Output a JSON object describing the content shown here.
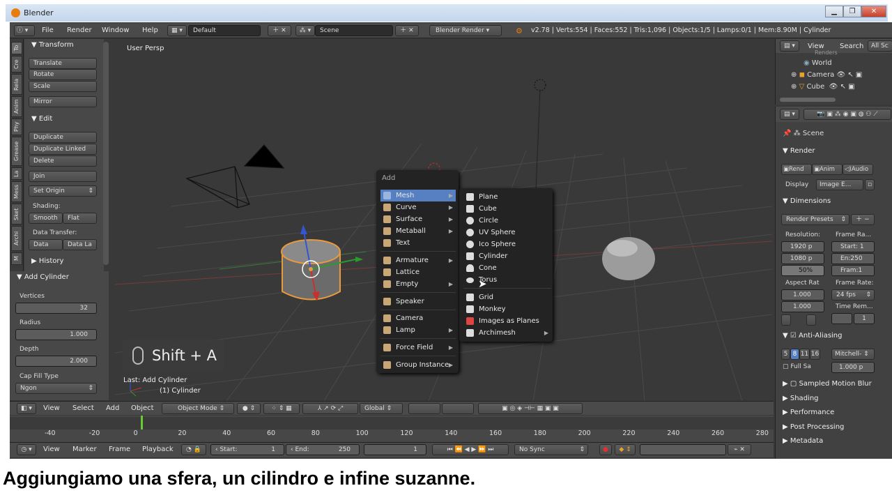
{
  "window": {
    "title": "Blender",
    "min": "▁",
    "max": "❐",
    "close": "✕"
  },
  "menubar": {
    "items": [
      "File",
      "Render",
      "Window",
      "Help"
    ],
    "layout": "Default",
    "scene": "Scene",
    "engine": "Blender Render",
    "stats": "v2.78 | Verts:554 | Faces:552 | Tris:1,096 | Objects:1/5 | Lamps:0/1 | Mem:8.90M | Cylinder"
  },
  "tabs": [
    "To",
    "Cre",
    "Rela",
    "Anim",
    "Phy",
    "Grease",
    "La",
    "Mess",
    "Sket",
    "Archi",
    "M"
  ],
  "tools": {
    "transform": {
      "title": "Transform",
      "buttons": [
        "Translate",
        "Rotate",
        "Scale",
        "Mirror"
      ]
    },
    "edit": {
      "title": "Edit",
      "buttons": [
        "Duplicate",
        "Duplicate Linked",
        "Delete",
        "Join"
      ],
      "set_origin": "Set Origin",
      "shading_label": "Shading:",
      "smooth": "Smooth",
      "flat": "Flat",
      "transfer_label": "Data Transfer:",
      "data": "Data",
      "data_la": "Data La"
    },
    "history": "History"
  },
  "operator": {
    "title": "Add Cylinder",
    "vertices_label": "Vertices",
    "vertices": "32",
    "radius_label": "Radius",
    "radius": "1.000",
    "depth_label": "Depth",
    "depth": "2.000",
    "cap_label": "Cap Fill Type",
    "cap": "Ngon"
  },
  "viewport": {
    "persp": "User Persp",
    "last_op": "Last: Add Cylinder",
    "object": "(1) Cylinder",
    "shortcut": "Shift + A"
  },
  "add_menu": {
    "title": "Add",
    "items": [
      {
        "label": "Mesh",
        "icon": "mesh-icon"
      },
      {
        "label": "Curve",
        "icon": "curve-icon"
      },
      {
        "label": "Surface",
        "icon": "surface-icon"
      },
      {
        "label": "Metaball",
        "icon": "metaball-icon"
      },
      {
        "label": "Text",
        "icon": "text-icon"
      },
      {
        "label": "Armature",
        "icon": "armature-icon"
      },
      {
        "label": "Lattice",
        "icon": "lattice-icon"
      },
      {
        "label": "Empty",
        "icon": "empty-icon"
      },
      {
        "label": "Speaker",
        "icon": "speaker-icon"
      },
      {
        "label": "Camera",
        "icon": "camera-icon"
      },
      {
        "label": "Lamp",
        "icon": "lamp-icon"
      },
      {
        "label": "Force Field",
        "icon": "force-field-icon"
      },
      {
        "label": "Group Instance",
        "icon": "group-instance-icon"
      }
    ]
  },
  "mesh_menu": {
    "items": [
      "Plane",
      "Cube",
      "Circle",
      "UV Sphere",
      "Ico Sphere",
      "Cylinder",
      "Cone",
      "Torus",
      "Grid",
      "Monkey",
      "Images as Planes",
      "Archimesh"
    ]
  },
  "vpheader": {
    "view": "View",
    "select": "Select",
    "add": "Add",
    "object": "Object",
    "mode": "Object Mode",
    "orientation": "Global"
  },
  "timeline": {
    "ticks": [
      "-40",
      "-20",
      "0",
      "20",
      "40",
      "60",
      "80",
      "100",
      "120",
      "140",
      "160",
      "180",
      "200",
      "220",
      "240",
      "260",
      "280"
    ],
    "view": "View",
    "marker": "Marker",
    "frame": "Frame",
    "playback": "Playback",
    "start_label": "Start:",
    "start": "1",
    "end_label": "End:",
    "end": "250",
    "current": "1",
    "sync": "No Sync"
  },
  "outliner": {
    "view": "View",
    "search": "Search",
    "all": "All Sc",
    "items": [
      "Renders",
      "World",
      "Camera",
      "Cube"
    ]
  },
  "props": {
    "scene": "Scene",
    "render": "Render",
    "rend": "Rend",
    "anim": "Anim",
    "audio": "Audio",
    "display_label": "Display",
    "display": "Image E...",
    "dimensions": "Dimensions",
    "presets": "Render Presets",
    "resolution": "Resolution:",
    "res_x": "1920 p",
    "res_y": "1080 p",
    "res_pct": "50%",
    "frame_range": "Frame Ra...",
    "start": "Start: 1",
    "end": "En:250",
    "fram": "Fram:1",
    "aspect": "Aspect Rat",
    "asp_x": "1.000",
    "asp_y": "1.000",
    "frame_rate": "Frame Rate:",
    "fps": "24 fps",
    "time_rem": "Time Rem...",
    "one": "1",
    "aa": "Anti-Aliasing",
    "aa_vals": [
      "5",
      "8",
      "11",
      "16"
    ],
    "filter": "Mitchell-",
    "full": "Full Sa",
    "filter_size": "1.000 p",
    "panels": [
      "Sampled Motion Blur",
      "Shading",
      "Performance",
      "Post Processing",
      "Metadata"
    ]
  },
  "caption": "Aggiungiamo una sfera,  un cilindro e infine suzanne."
}
